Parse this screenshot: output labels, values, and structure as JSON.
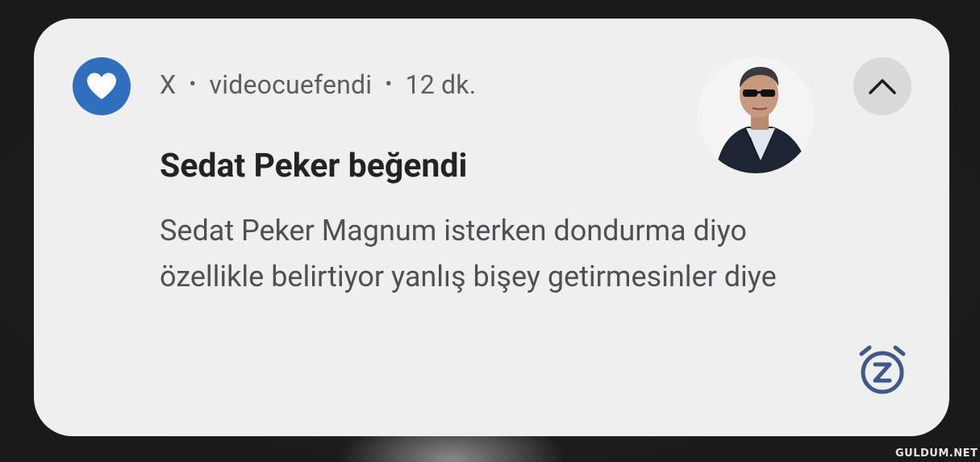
{
  "notification": {
    "app_name": "X",
    "separator": "•",
    "author": "videocuefendi",
    "time": "12 dk.",
    "title": "Sedat Peker beğendi",
    "body_line1": "Sedat Peker Magnum isterken dondurma diyo",
    "body_line2": "özellikle belirtiyor yanlış bişey getirmesinler diye",
    "app_icon": "heart-icon",
    "expand_icon": "chevron-up-icon",
    "snooze_icon": "snooze-alarm-icon"
  },
  "watermark": {
    "text": "GULDUM.NET"
  },
  "colors": {
    "card_background": "#efefef",
    "app_icon_background": "#2f6fbe",
    "snooze_icon": "#3f5a8a",
    "expand_button_background": "#d9d9db"
  }
}
